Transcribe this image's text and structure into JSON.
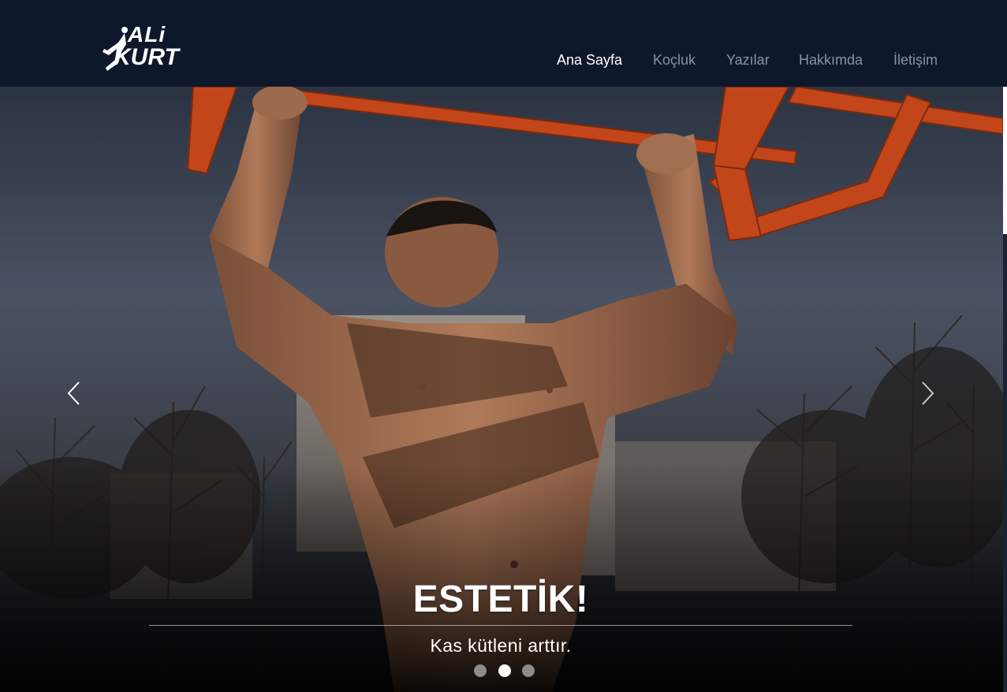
{
  "brand": {
    "logo_line1": "ALi",
    "logo_line2": "KURT"
  },
  "nav": {
    "items": [
      {
        "label": "Ana Sayfa",
        "active": true
      },
      {
        "label": "Koçluk",
        "active": false
      },
      {
        "label": "Yazılar",
        "active": false
      },
      {
        "label": "Hakkımda",
        "active": false
      },
      {
        "label": "İletişim",
        "active": false
      }
    ]
  },
  "carousel": {
    "slide_title": "ESTETİK!",
    "slide_subtitle": "Kas kütleni arttır.",
    "indicator_count": 3,
    "active_index": 1,
    "prev_icon": "chevron-left-icon",
    "next_icon": "chevron-right-icon"
  },
  "colors": {
    "header_bg": "#0f172a",
    "nav_active": "#ffffff",
    "nav_inactive": "#8a93a6",
    "bar_orange": "#c2461a"
  }
}
